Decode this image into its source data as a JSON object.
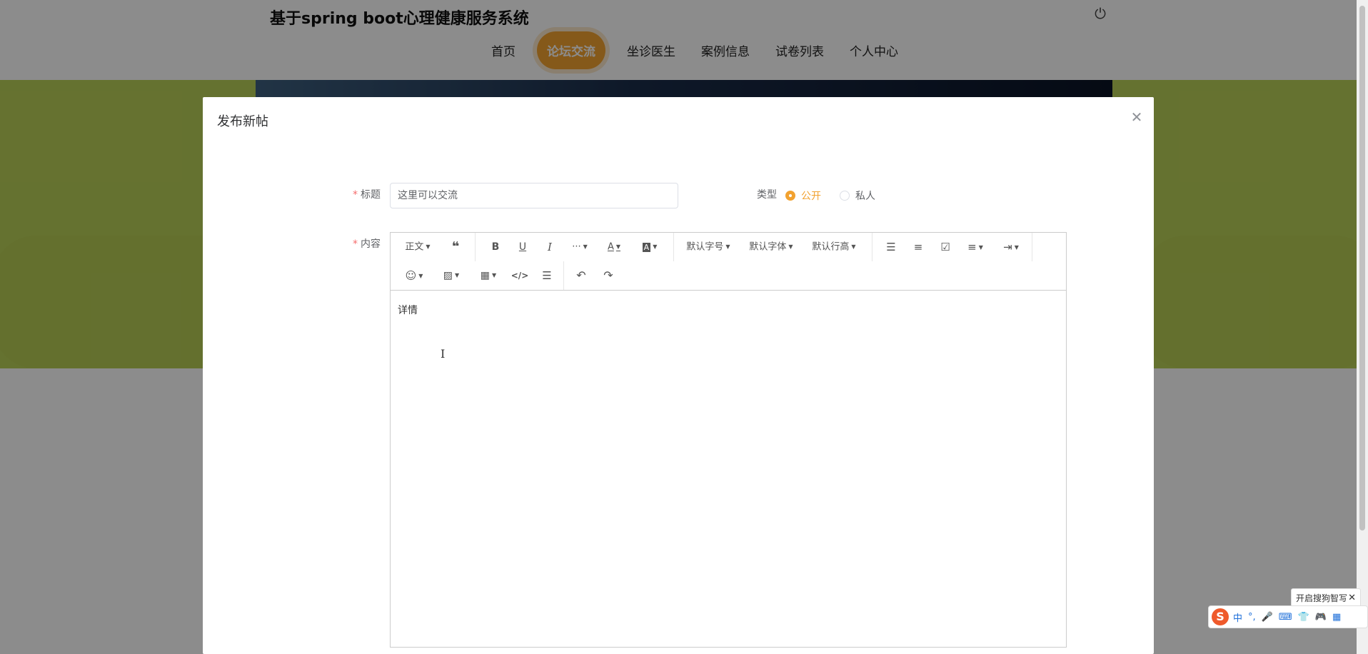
{
  "site": {
    "title": "基于spring boot心理健康服务系统",
    "power_icon": "power-icon"
  },
  "nav": {
    "items": [
      {
        "label": "首页",
        "active": false
      },
      {
        "label": "论坛交流",
        "active": true
      },
      {
        "label": "坐诊医生",
        "active": false
      },
      {
        "label": "案例信息",
        "active": false
      },
      {
        "label": "试卷列表",
        "active": false
      },
      {
        "label": "个人中心",
        "active": false
      }
    ]
  },
  "modal": {
    "title": "发布新帖",
    "close_icon": "close-icon",
    "form": {
      "title_label": "标题",
      "title_value": "这里可以交流",
      "type_label": "类型",
      "type_options": [
        "公开",
        "私人"
      ],
      "type_selected": "公开",
      "content_label": "内容",
      "content_text": "详情"
    },
    "toolbar": {
      "paragraph": "正文",
      "font_size": "默认字号",
      "font_family": "默认字体",
      "line_height": "默认行高",
      "icons": [
        "quote-icon",
        "bold-icon",
        "underline-icon",
        "italic-icon",
        "more-icon",
        "font-color-icon",
        "bg-color-icon",
        "bullet-list-icon",
        "numbered-list-icon",
        "todo-icon",
        "align-icon",
        "indent-icon",
        "emoji-icon",
        "image-icon",
        "table-icon",
        "code-icon",
        "divider-icon",
        "undo-icon",
        "redo-icon"
      ]
    }
  },
  "ime": {
    "tip": "开启搜狗智写",
    "lang": "中"
  },
  "colors": {
    "accent": "#f2a230",
    "required": "#f56c6c",
    "banner_green": "#b9cf58"
  }
}
